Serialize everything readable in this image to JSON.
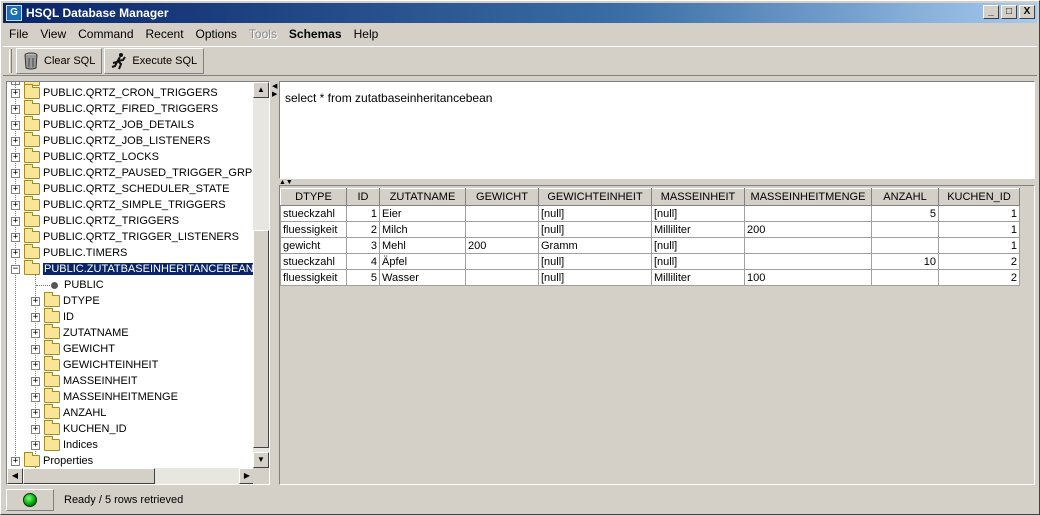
{
  "window": {
    "title": "HSQL Database Manager",
    "icon": "hsql-app-icon",
    "controls": {
      "minimize": "_",
      "maximize": "□",
      "close": "X"
    }
  },
  "menubar": {
    "items": [
      {
        "label": "File",
        "disabled": false
      },
      {
        "label": "View",
        "disabled": false
      },
      {
        "label": "Command",
        "disabled": false
      },
      {
        "label": "Recent",
        "disabled": false
      },
      {
        "label": "Options",
        "disabled": false
      },
      {
        "label": "Tools",
        "disabled": true
      },
      {
        "label": "Schemas",
        "disabled": false,
        "bold": true
      },
      {
        "label": "Help",
        "disabled": false
      }
    ]
  },
  "toolbar": {
    "clear_label": "Clear SQL",
    "execute_label": "Execute SQL"
  },
  "tree": {
    "tables": [
      "PUBLIC.QRTZ_CRON_TRIGGERS",
      "PUBLIC.QRTZ_FIRED_TRIGGERS",
      "PUBLIC.QRTZ_JOB_DETAILS",
      "PUBLIC.QRTZ_JOB_LISTENERS",
      "PUBLIC.QRTZ_LOCKS",
      "PUBLIC.QRTZ_PAUSED_TRIGGER_GRPS",
      "PUBLIC.QRTZ_SCHEDULER_STATE",
      "PUBLIC.QRTZ_SIMPLE_TRIGGERS",
      "PUBLIC.QRTZ_TRIGGERS",
      "PUBLIC.QRTZ_TRIGGER_LISTENERS",
      "PUBLIC.TIMERS"
    ],
    "selected_table": "PUBLIC.ZUTATBASEINHERITANCEBEAN",
    "schema_node": "PUBLIC",
    "columns": [
      "DTYPE",
      "ID",
      "ZUTATNAME",
      "GEWICHT",
      "GEWICHTEINHEIT",
      "MASSEINHEIT",
      "MASSEINHEITMENGE",
      "ANZAHL",
      "KUCHEN_ID",
      "Indices"
    ],
    "properties": "Properties"
  },
  "sql": {
    "query": "select * from zutatbaseinheritancebean"
  },
  "results": {
    "headers": [
      "DTYPE",
      "ID",
      "ZUTATNAME",
      "GEWICHT",
      "GEWICHTEINHEIT",
      "MASSEINHEIT",
      "MASSEINHEITMENGE",
      "ANZAHL",
      "KUCHEN_ID"
    ],
    "rows": [
      [
        "stueckzahl",
        "1",
        "Eier",
        "",
        "[null]",
        "[null]",
        "",
        "5",
        "1"
      ],
      [
        "fluessigkeit",
        "2",
        "Milch",
        "",
        "[null]",
        "Milliliter",
        "200",
        "",
        "1"
      ],
      [
        "gewicht",
        "3",
        "Mehl",
        "200",
        "Gramm",
        "[null]",
        "",
        "",
        "1"
      ],
      [
        "stueckzahl",
        "4",
        "Äpfel",
        "",
        "[null]",
        "[null]",
        "",
        "10",
        "2"
      ],
      [
        "fluessigkeit",
        "5",
        "Wasser",
        "",
        "[null]",
        "Milliliter",
        "100",
        "",
        "2"
      ]
    ]
  },
  "status": {
    "text": "Ready / 5 rows retrieved",
    "light_color": "#00a000"
  }
}
